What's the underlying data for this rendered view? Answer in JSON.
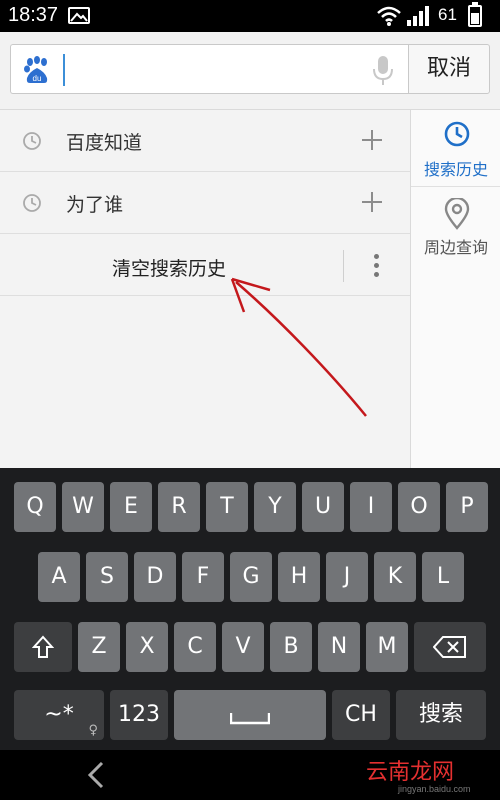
{
  "status": {
    "time": "18:37",
    "battery": "61"
  },
  "search": {
    "placeholder": "",
    "cancel_label": "取消"
  },
  "history": [
    {
      "text": "百度知道"
    },
    {
      "text": "为了谁"
    }
  ],
  "clear_label": "清空搜索历史",
  "side_panel": {
    "history_label": "搜索历史",
    "nearby_label": "周边查询"
  },
  "keyboard": {
    "row1": [
      "Q",
      "W",
      "E",
      "R",
      "T",
      "Y",
      "U",
      "I",
      "O",
      "P"
    ],
    "row2": [
      "A",
      "S",
      "D",
      "F",
      "G",
      "H",
      "J",
      "K",
      "L"
    ],
    "row3": [
      "Z",
      "X",
      "C",
      "V",
      "B",
      "N",
      "M"
    ],
    "symbols_label": "~*",
    "numbers_label": "123",
    "ch_label": "CH",
    "search_label": "搜索"
  },
  "watermark": {
    "text": "云南龙网",
    "sub": "jingyan.baidu.com"
  },
  "colors": {
    "accent": "#1f6fc8",
    "arrow": "#c4181c"
  }
}
